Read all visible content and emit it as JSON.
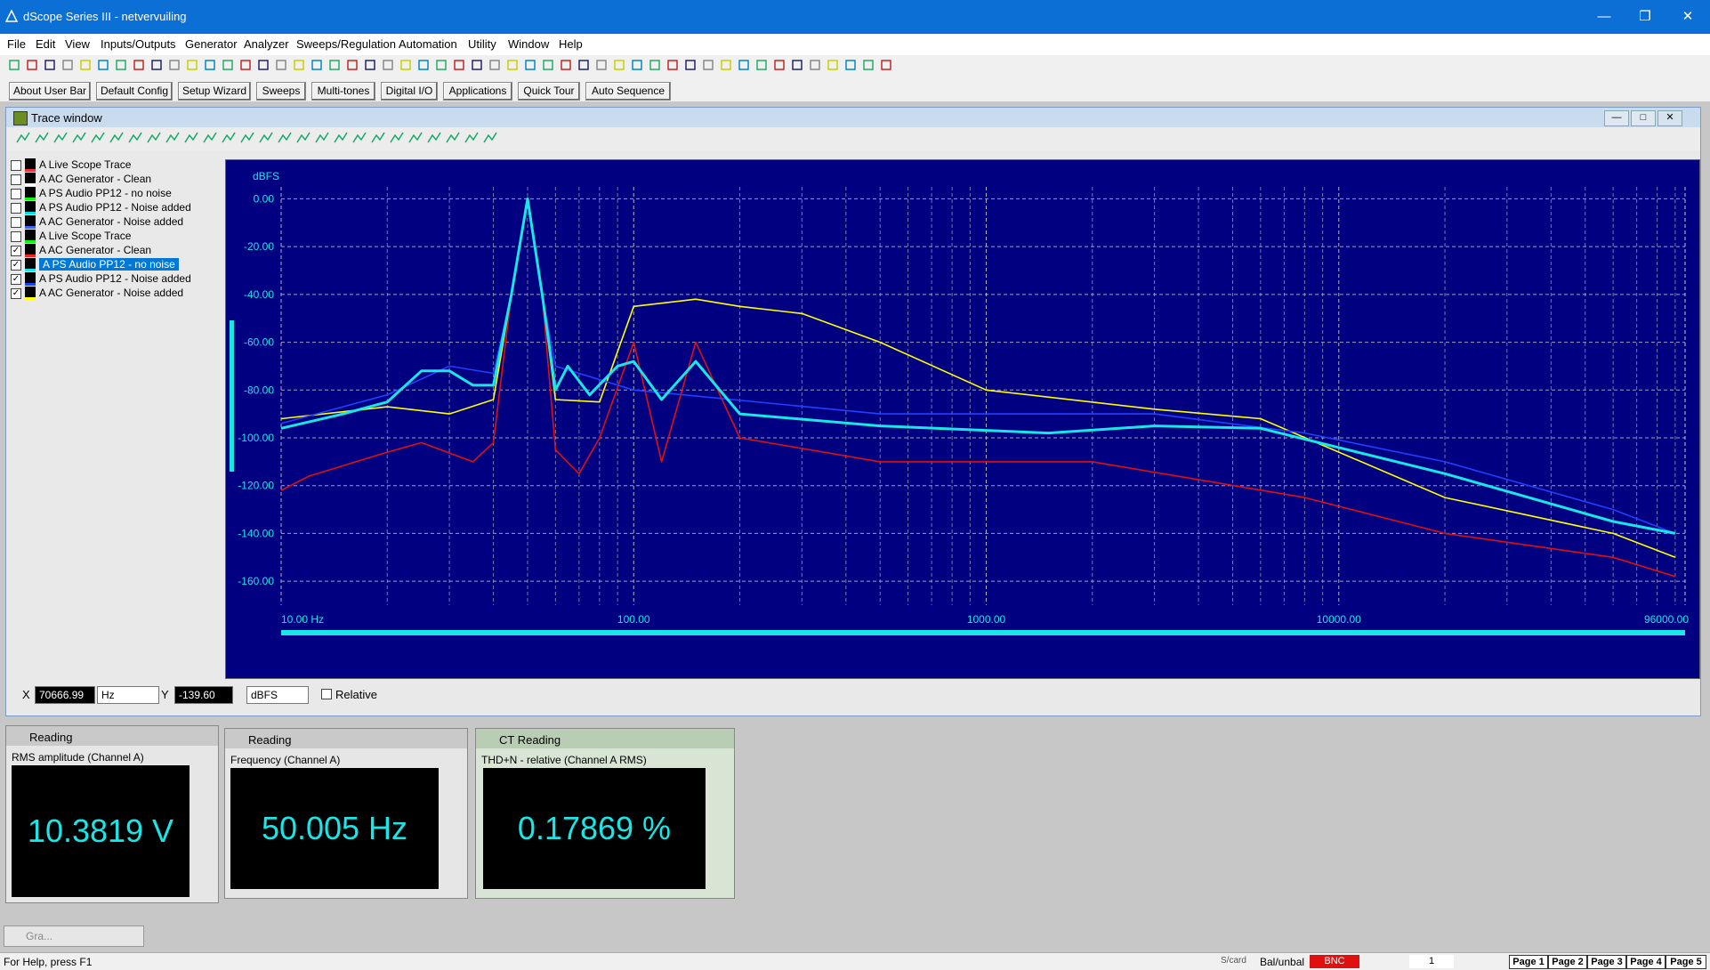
{
  "window": {
    "title": "dScope Series III - netvervuiling"
  },
  "menu": [
    "File",
    "Edit",
    "View",
    "Inputs/Outputs",
    "Generator",
    "Analyzer",
    "Sweeps/Regulation",
    "Automation",
    "Utility",
    "Window",
    "Help"
  ],
  "user_bar": [
    "About User Bar",
    "Default Config",
    "Setup Wizard",
    "Sweeps",
    "Multi-tones",
    "Digital I/O",
    "Applications",
    "Quick Tour",
    "Auto Sequence"
  ],
  "trace_window": {
    "title": "Trace window",
    "legend": [
      {
        "label": "A  Live Scope Trace",
        "checked": false,
        "color": "#ff3030"
      },
      {
        "label": "A  AC Generator - Clean",
        "checked": false,
        "color": "#ffffff"
      },
      {
        "label": "A  PS Audio PP12 - no noise",
        "checked": false,
        "color": "#00ff00"
      },
      {
        "label": "A  PS Audio PP12 - Noise added",
        "checked": false,
        "color": "#00e0e0"
      },
      {
        "label": "A  AC Generator - Noise added",
        "checked": false,
        "color": "#4060ff"
      },
      {
        "label": "A  Live Scope Trace",
        "checked": false,
        "color": "#00ff00"
      },
      {
        "label": "A  AC Generator - Clean",
        "checked": true,
        "color": "#ff2020"
      },
      {
        "label": "A  PS Audio PP12 - no noise",
        "checked": true,
        "color": "#19e6e6",
        "selected": true
      },
      {
        "label": "A  PS Audio PP12 - Noise added",
        "checked": true,
        "color": "#2040ff"
      },
      {
        "label": "A  AC Generator - Noise added",
        "checked": true,
        "color": "#ffff00"
      }
    ],
    "cursor": {
      "x_label": "X",
      "x_value": "70666.99",
      "x_unit": "Hz",
      "y_label": "Y",
      "y_value": "-139.60",
      "y_unit": "dBFS",
      "relative_label": "Relative"
    }
  },
  "chart_data": {
    "type": "line",
    "ylabel": "dBFS",
    "xscale": "log",
    "xlim": [
      10,
      96000
    ],
    "ylim": [
      -170,
      5
    ],
    "yticks": [
      "0.00",
      "-20.00",
      "-40.00",
      "-60.00",
      "-80.00",
      "-100.00",
      "-120.00",
      "-140.00",
      "-160.00"
    ],
    "xticks": [
      "10.00 Hz",
      "100.00",
      "1000.00",
      "10000.00",
      "96000.00"
    ],
    "grid": true,
    "series": [
      {
        "name": "AC Generator - Clean",
        "color": "#e01010",
        "points": [
          [
            10,
            -122
          ],
          [
            12,
            -116
          ],
          [
            20,
            -106
          ],
          [
            25,
            -102
          ],
          [
            35,
            -110
          ],
          [
            40,
            -102
          ],
          [
            45,
            -40
          ],
          [
            50,
            0
          ],
          [
            55,
            -40
          ],
          [
            60,
            -105
          ],
          [
            70,
            -115
          ],
          [
            80,
            -100
          ],
          [
            100,
            -60
          ],
          [
            120,
            -110
          ],
          [
            150,
            -60
          ],
          [
            200,
            -100
          ],
          [
            500,
            -110
          ],
          [
            2000,
            -110
          ],
          [
            8000,
            -125
          ],
          [
            20000,
            -140
          ],
          [
            60000,
            -150
          ],
          [
            90000,
            -158
          ]
        ]
      },
      {
        "name": "AC Generator - Noise added",
        "color": "#ffff00",
        "points": [
          [
            10,
            -92
          ],
          [
            20,
            -87
          ],
          [
            30,
            -90
          ],
          [
            40,
            -84
          ],
          [
            45,
            -40
          ],
          [
            50,
            0
          ],
          [
            55,
            -40
          ],
          [
            60,
            -84
          ],
          [
            80,
            -85
          ],
          [
            100,
            -45
          ],
          [
            150,
            -42
          ],
          [
            200,
            -45
          ],
          [
            300,
            -48
          ],
          [
            500,
            -60
          ],
          [
            1000,
            -80
          ],
          [
            3000,
            -88
          ],
          [
            6000,
            -92
          ],
          [
            20000,
            -125
          ],
          [
            60000,
            -140
          ],
          [
            90000,
            -150
          ]
        ]
      },
      {
        "name": "PS Audio PP12 - Noise added",
        "color": "#2040ff",
        "points": [
          [
            10,
            -94
          ],
          [
            20,
            -82
          ],
          [
            30,
            -70
          ],
          [
            40,
            -73
          ],
          [
            45,
            -40
          ],
          [
            50,
            0
          ],
          [
            55,
            -40
          ],
          [
            60,
            -70
          ],
          [
            100,
            -80
          ],
          [
            500,
            -90
          ],
          [
            3000,
            -90
          ],
          [
            8000,
            -98
          ],
          [
            20000,
            -110
          ],
          [
            60000,
            -130
          ],
          [
            90000,
            -140
          ]
        ]
      },
      {
        "name": "PS Audio PP12 - no noise",
        "color": "#19e6e6",
        "points": [
          [
            10,
            -96
          ],
          [
            15,
            -90
          ],
          [
            20,
            -85
          ],
          [
            25,
            -72
          ],
          [
            30,
            -72
          ],
          [
            35,
            -78
          ],
          [
            40,
            -78
          ],
          [
            45,
            -40
          ],
          [
            50,
            0
          ],
          [
            55,
            -40
          ],
          [
            60,
            -80
          ],
          [
            65,
            -70
          ],
          [
            75,
            -82
          ],
          [
            90,
            -70
          ],
          [
            100,
            -68
          ],
          [
            120,
            -84
          ],
          [
            150,
            -68
          ],
          [
            200,
            -90
          ],
          [
            500,
            -95
          ],
          [
            1500,
            -98
          ],
          [
            3000,
            -95
          ],
          [
            6000,
            -96
          ],
          [
            20000,
            -115
          ],
          [
            60000,
            -135
          ],
          [
            90000,
            -140
          ]
        ]
      }
    ]
  },
  "readings": [
    {
      "title": "Reading",
      "label": "RMS amplitude (Channel A)",
      "value": "10.3819 V"
    },
    {
      "title": "Reading",
      "label": "Frequency (Channel A)",
      "value": "50.005 Hz"
    },
    {
      "title": "CT Reading",
      "label": "THD+N - relative (Channel A RMS)",
      "value": "0.17869 %"
    }
  ],
  "minimized": {
    "label": "Gra..."
  },
  "status": {
    "help": "For Help, press F1",
    "items": [
      "S/card",
      "Bal/unbal",
      "BNC",
      "1"
    ],
    "pages": [
      "Page 1",
      "Page 2",
      "Page 3",
      "Page 4",
      "Page 5"
    ]
  }
}
